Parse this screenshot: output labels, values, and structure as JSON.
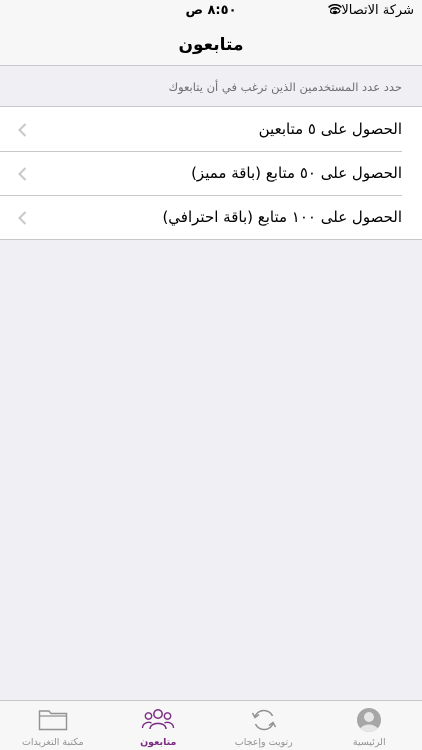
{
  "status_bar": {
    "carrier": "شركة الاتصالات",
    "time": "٨:٥٠ ص"
  },
  "nav": {
    "title": "متابعون"
  },
  "section_header": "حدد عدد المستخدمين الذين ترغب في أن يتابعوك",
  "options": [
    {
      "label": "الحصول على ٥ متابعين"
    },
    {
      "label": "الحصول على ٥٠ متابع (باقة مميز)"
    },
    {
      "label": "الحصول على ١٠٠ متابع (باقة احترافي)"
    }
  ],
  "tabs": [
    {
      "label": "مكتبة التغريدات",
      "icon": "folder-icon"
    },
    {
      "label": "متابعون",
      "icon": "people-icon",
      "active": true
    },
    {
      "label": "رتويت وإعجاب",
      "icon": "refresh-icon"
    },
    {
      "label": "الرئيسية",
      "icon": "user-icon"
    }
  ],
  "colors": {
    "accent": "#7b2c83",
    "inactive": "#929292",
    "background": "#efeff4",
    "bar": "#f7f7f7"
  }
}
